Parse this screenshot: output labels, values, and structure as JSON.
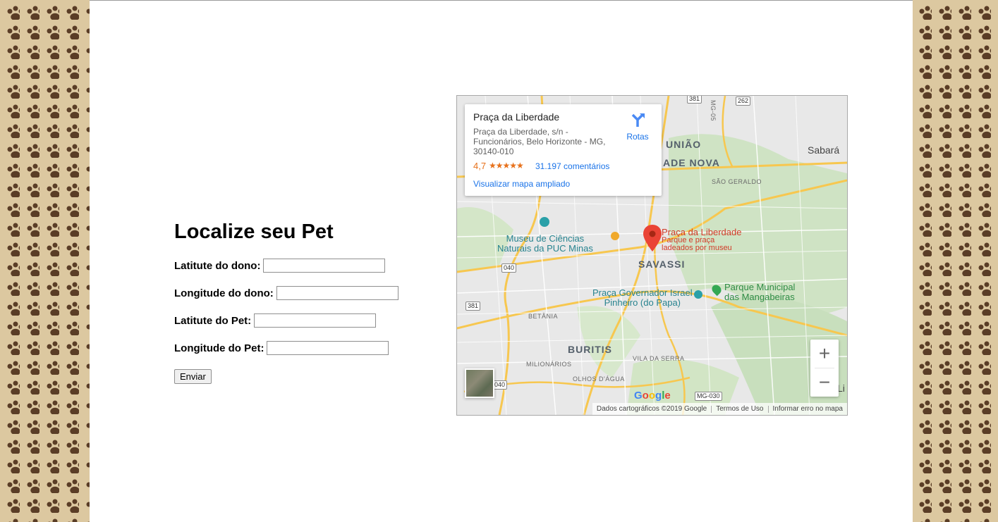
{
  "form": {
    "title": "Localize seu Pet",
    "fields": [
      {
        "label": "Latitute do dono:",
        "value": ""
      },
      {
        "label": "Longitude do dono:",
        "value": ""
      },
      {
        "label": "Latitute do Pet:",
        "value": ""
      },
      {
        "label": "Longitude do Pet:",
        "value": ""
      }
    ],
    "submit_label": "Enviar"
  },
  "map": {
    "info_card": {
      "title": "Praça da Liberdade",
      "address": "Praça da Liberdade, s/n - Funcionários, Belo Horizonte - MG, 30140-010",
      "rating": "4,7",
      "stars": "★★★★★",
      "reviews": "31.197 comentários",
      "larger_map_link": "Visualizar mapa ampliado",
      "directions_label": "Rotas",
      "directions_icon": "directions-icon"
    },
    "labels": {
      "uniao": "UNIÃO",
      "cidade_nova": "ADE NOVA",
      "sabara": "Sabará",
      "sao_geraldo": "SÃO GERALDO",
      "museu": "Museu de Ciências\nNaturais da PUC Minas",
      "marker_title": "Praça da Liberdade",
      "marker_subtitle": "Parque e praça\nladeados por museu",
      "savassi": "SAVASSI",
      "praca_governador": "Praça Governador Israel\nPinheiro (do Papa)",
      "parque_municipal": "Parque Municipal\ndas Mangabeiras",
      "betania": "BETÂNIA",
      "buritis": "BURITIS",
      "milionarios": "MILIONÁRIOS",
      "vila_da_serra": "VILA DA SERRA",
      "olhos_dagua": "OLHOS D'ÁGUA",
      "li": "Li"
    },
    "shields": {
      "r381_top": "381",
      "r262": "262",
      "mg05": "MG-05",
      "r040": "040",
      "r381": "381",
      "r040_bottom": "040",
      "mg030": "MG-030"
    },
    "controls": {
      "zoom_in": "+",
      "zoom_out": "−"
    },
    "google_logo": "Google",
    "footer": {
      "map_data": "Dados cartográficos ©2019 Google",
      "terms": "Termos de Uso",
      "report": "Informar erro no mapa"
    },
    "colors": {
      "marker": "#ea4335",
      "link": "#1a73e8",
      "rating": "#e7711b"
    }
  }
}
